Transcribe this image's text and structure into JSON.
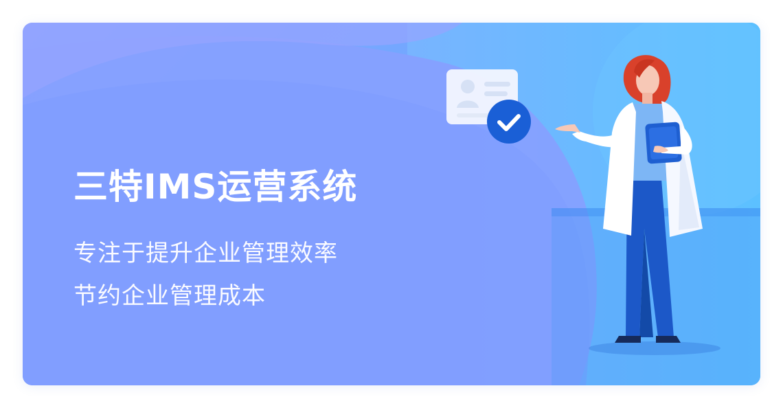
{
  "banner": {
    "title": "三特IMS运营系统",
    "subtitle_line1": "专注于提升企业管理效率",
    "subtitle_line2": "节约企业管理成本"
  },
  "colors": {
    "background_left": "#8aa4ff",
    "background_right": "#5fb7ff",
    "accent_blue": "#1a5fd6",
    "text": "#ffffff",
    "hair": "#d9412b"
  },
  "icons": {
    "profile_card": "id-card-icon",
    "check_badge": "check-icon"
  }
}
